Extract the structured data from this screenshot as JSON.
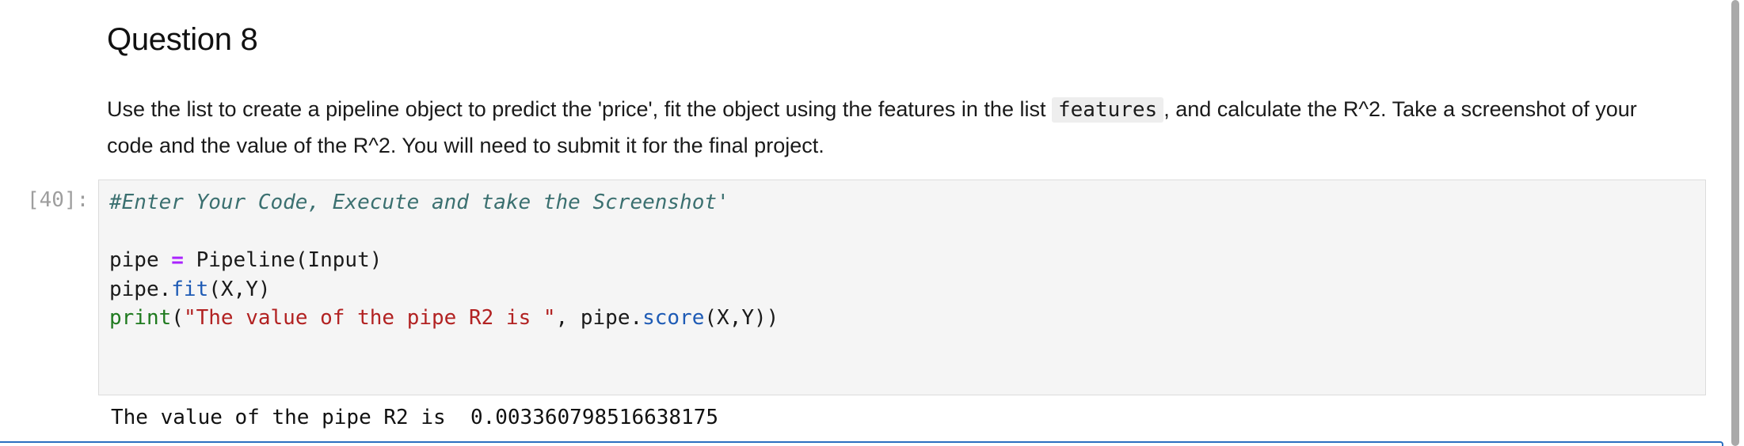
{
  "markdown": {
    "heading": "Question 8",
    "para_before_code": "Use the list to create a pipeline object to predict the 'price', fit the object using the features in the list ",
    "inline_code": "features",
    "para_after_code": ", and calculate the R^2. Take a screenshot of your code and the value of the R^2. You will need to submit it for the final project."
  },
  "code_cell": {
    "prompt": "[40]:",
    "comment": "#Enter Your Code, Execute and take the Screenshot'",
    "line2": {
      "var": "pipe",
      "op": "=",
      "call": "Pipeline(Input)"
    },
    "line3": {
      "obj": "pipe.",
      "method": "fit",
      "args": "(X,Y)"
    },
    "line4": {
      "func": "print",
      "open": "(",
      "string": "\"The value of the pipe R2 is \"",
      "mid": ", pipe.",
      "method": "score",
      "args": "(X,Y))"
    }
  },
  "output": {
    "text": "The value of the pipe R2 is  0.003360798516638175"
  },
  "colors": {
    "active_cell_border": "#2b6fbf",
    "code_background": "#f5f5f5",
    "comment": "#3b7070",
    "string": "#b22222",
    "builtin": "#1f7a1f",
    "attribute": "#1e5bb5",
    "operator": "#aa22ff"
  }
}
